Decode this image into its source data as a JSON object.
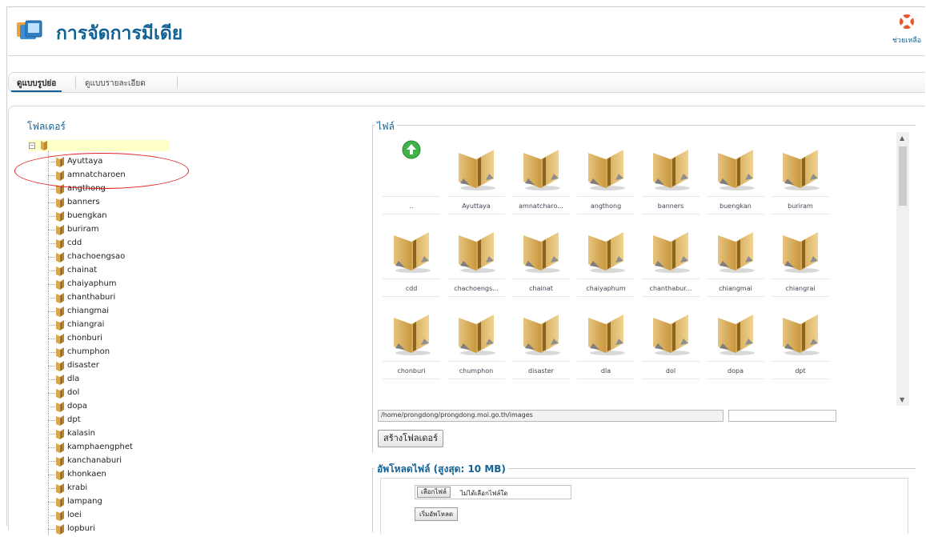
{
  "header": {
    "title": "การจัดการมีเดีย",
    "help_label": "ช่วยเหลือ"
  },
  "tabs": [
    {
      "label": "ดูแบบรูปย่อ",
      "active": true
    },
    {
      "label": "ดูแบบรายละเอียด",
      "active": false
    }
  ],
  "folders": {
    "title": "โฟลเดอร์",
    "items": [
      "Ayuttaya",
      "amnatcharoen",
      "angthong",
      "banners",
      "buengkan",
      "buriram",
      "cdd",
      "chachoengsao",
      "chainat",
      "chaiyaphum",
      "chanthaburi",
      "chiangmai",
      "chiangrai",
      "chonburi",
      "chumphon",
      "disaster",
      "dla",
      "dol",
      "dopa",
      "dpt",
      "kalasin",
      "kamphaengphet",
      "kanchanaburi",
      "khonkaen",
      "krabi",
      "lampang",
      "loei",
      "lopburi"
    ]
  },
  "files": {
    "title": "ไฟล์",
    "up_label": "..",
    "items": [
      "Ayuttaya",
      "amnatcharo...",
      "angthong",
      "banners",
      "buengkan",
      "buriram",
      "cdd",
      "chachoengs...",
      "chainat",
      "chaiyaphum",
      "chanthabur...",
      "chiangmai",
      "chiangrai",
      "chonburi",
      "chumphon",
      "disaster",
      "dla",
      "dol",
      "dopa",
      "dpt"
    ],
    "path": "/home/prongdong/prongdong.moi.go.th/images",
    "new_folder_value": "",
    "create_folder_button": "สร้างโฟลเดอร์"
  },
  "upload": {
    "title": "อัพโหลดไฟล์ (สูงสุด: 10 MB)",
    "choose_button": "เลือกไฟล์",
    "no_file_text": "ไม่ได้เลือกไฟล์ใด",
    "start_button": "เริ่มอัพโหลด"
  },
  "colors": {
    "accent": "#146295",
    "annotation": "#e02020"
  }
}
